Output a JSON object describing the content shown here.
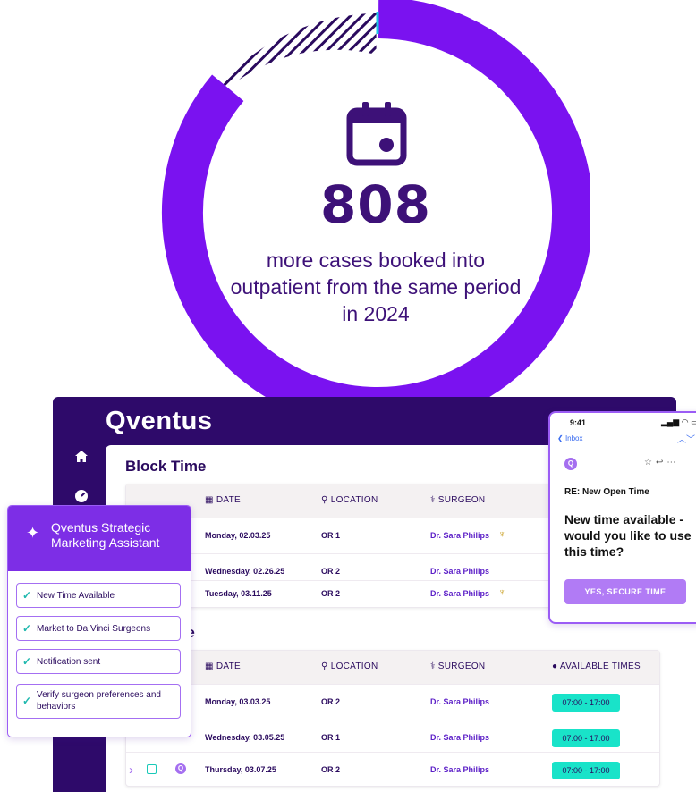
{
  "stat": {
    "number": "808",
    "caption": "more cases booked into outpatient from the same period in 2024",
    "ring_progress": 0.86,
    "icon": "calendar-icon",
    "colors": {
      "ring": "#7a12f0",
      "text": "#3d1178"
    }
  },
  "app": {
    "logo": "Qventus",
    "sidebar_icons": [
      "home-icon",
      "dashboard-gauge-icon"
    ],
    "block_table": {
      "title": "Block Time",
      "headers": {
        "date": "DATE",
        "location": "LOCATION",
        "surgeon": "SURGEON"
      },
      "rows": [
        {
          "date": "Monday, 02.03.25",
          "location": "OR 1",
          "surgeon": "Dr. Sara Philips",
          "robot": true
        },
        {
          "date": "Wednesday, 02.26.25",
          "location": "OR 2",
          "surgeon": "Dr. Sara Philips",
          "robot": false
        },
        {
          "date": "Tuesday, 03.11.25",
          "location": "OR 2",
          "surgeon": "Dr. Sara Philips",
          "robot": true
        }
      ]
    },
    "open_table": {
      "title_visible": "ne",
      "headers": {
        "date": "DATE",
        "location": "LOCATION",
        "surgeon": "SURGEON",
        "times": "AVAILABLE TIMES"
      },
      "rows": [
        {
          "date": "Monday, 03.03.25",
          "location": "OR 2",
          "surgeon": "Dr. Sara Philips",
          "time": "07:00 - 17:00"
        },
        {
          "date": "Wednesday, 03.05.25",
          "location": "OR 1",
          "surgeon": "Dr. Sara Philips",
          "time": "07:00 - 17:00"
        },
        {
          "date": "Thursday, 03.07.25",
          "location": "OR 2",
          "surgeon": "Dr. Sara Philips",
          "time": "07:00 - 17:00"
        }
      ]
    }
  },
  "assistant": {
    "title": "Qventus Strategic Marketing Assistant",
    "tasks": [
      "New Time Available",
      "Market to Da Vinci Surgeons",
      "Notification sent",
      "Verify surgeon preferences and behaviors"
    ]
  },
  "phone": {
    "time": "9:41",
    "back_label": "Inbox",
    "avatar": "Q",
    "subject": "RE: New Open Time",
    "body": "New time available - would you like to use this time?",
    "button": "YES, SECURE TIME"
  }
}
